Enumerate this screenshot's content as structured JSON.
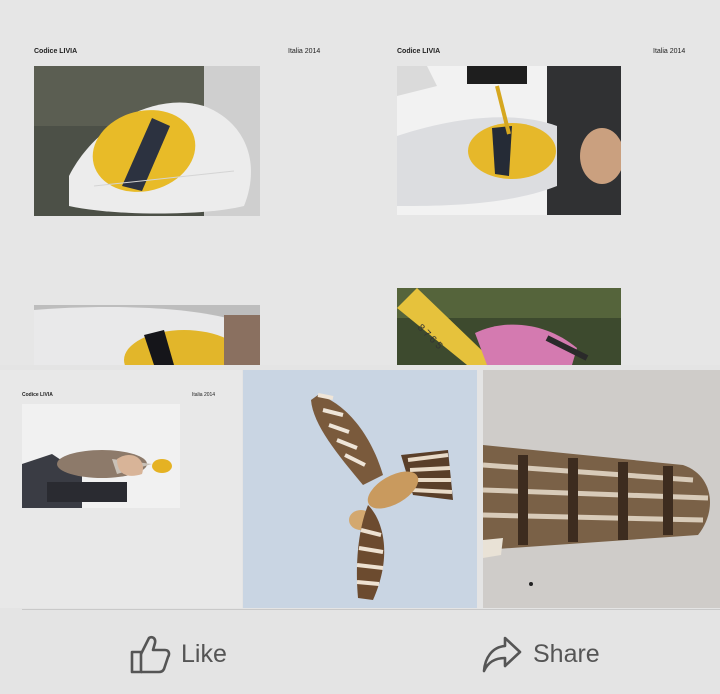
{
  "doc_top": {
    "left_header": {
      "title": "Codice LIVIA",
      "date": "Italia 2014"
    },
    "right_header": {
      "title": "Codice LIVIA",
      "date": "Italia 2014"
    }
  },
  "doc_thumb": {
    "title": "Codice LIVIA",
    "date": "Italia 2014"
  },
  "actions": {
    "like_label": "Like",
    "share_label": "Share"
  },
  "icons": {
    "like": "thumbs-up-icon",
    "share": "share-arrow-icon"
  }
}
